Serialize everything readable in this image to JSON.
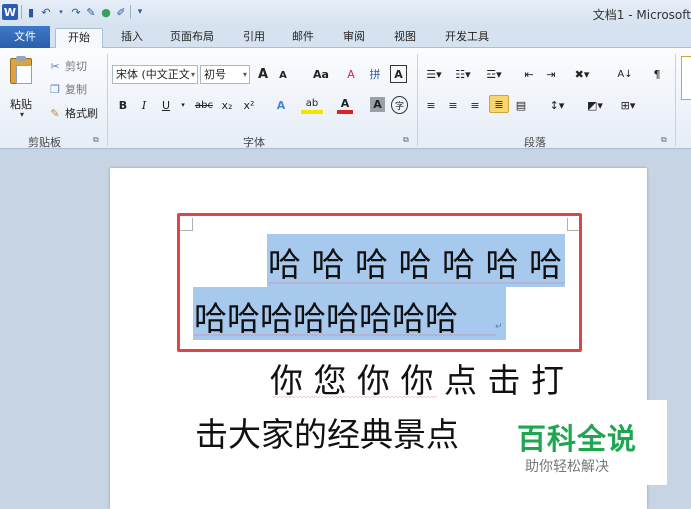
{
  "window": {
    "title": "文档1 - Microsoft"
  },
  "quick_access": {
    "items": [
      {
        "name": "word-logo-icon",
        "glyph": "W"
      },
      {
        "name": "save-icon",
        "glyph": "▮"
      },
      {
        "name": "undo-icon",
        "glyph": "↶"
      },
      {
        "name": "redo-icon",
        "glyph": "↷"
      },
      {
        "name": "format-painter-qat-icon",
        "glyph": "✎"
      },
      {
        "name": "color-icon",
        "glyph": "●"
      },
      {
        "name": "draw-icon",
        "glyph": "✐"
      },
      {
        "name": "customize-qat-icon",
        "glyph": "▾"
      }
    ]
  },
  "tabs": {
    "file": "文件",
    "home": "开始",
    "insert": "插入",
    "page_layout": "页面布局",
    "references": "引用",
    "mailings": "邮件",
    "review": "审阅",
    "view": "视图",
    "developer": "开发工具"
  },
  "clipboard": {
    "paste": "粘贴",
    "cut": "剪切",
    "copy": "复制",
    "format_painter": "格式刷",
    "group_label": "剪贴板"
  },
  "font": {
    "name": "宋体 (中文正文",
    "size": "初号",
    "grow": "A",
    "shrink": "A",
    "change_case": "Aa",
    "clear_format": "A",
    "phonetic": "拼",
    "char_border": "A",
    "bold": "B",
    "italic": "I",
    "underline": "U",
    "strikethrough": "abc",
    "subscript": "x₂",
    "superscript": "x²",
    "text_effects": "A",
    "highlight": "ab",
    "font_color": "A",
    "char_shading": "A",
    "enclose": "字",
    "group_label": "字体",
    "colors": {
      "highlight": "#f4e400",
      "font_color": "#e02020"
    }
  },
  "paragraph": {
    "group_label": "段落"
  },
  "document": {
    "line1": "哈 哈 哈 哈 哈 哈 哈",
    "line2": "哈哈哈哈哈哈哈哈",
    "line3": "你 您 你 你 点 击 打",
    "line4": "击大家的经典景点",
    "paragraph_mark": "↵"
  },
  "watermark": {
    "title": "百科全说",
    "subtitle": "助你轻松解决"
  },
  "colors": {
    "accent": "#2a5eaa",
    "selection": "#a8c9ee",
    "annotation_box": "#e04545",
    "watermark_green": "#1fa750"
  }
}
